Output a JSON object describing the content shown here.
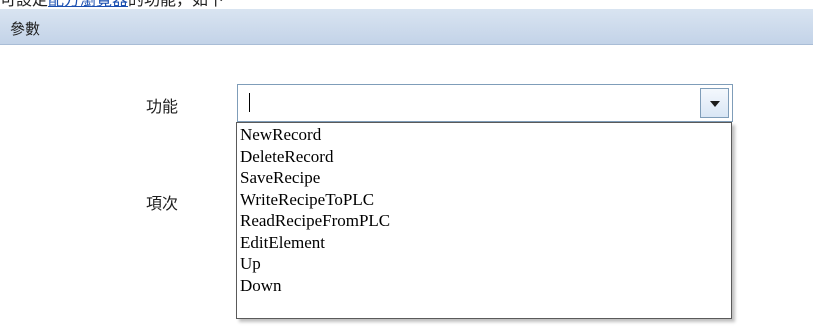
{
  "caption": {
    "prefix": "可設定",
    "link": "配方瀏覽器",
    "suffix": "的功能，如下"
  },
  "group": {
    "title": "參數"
  },
  "form": {
    "function_label": "功能",
    "item_label": "項次",
    "function_value": ""
  },
  "dropdown": {
    "options": [
      "NewRecord",
      "DeleteRecord",
      "SaveRecipe",
      "WriteRecipeToPLC",
      "ReadRecipeFromPLC",
      "EditElement",
      "Up",
      "Down"
    ]
  },
  "icons": {
    "dropdown_toggle": "chevron-down-icon"
  },
  "colors": {
    "header_bar": "#c8d7ea",
    "combo_border": "#7f9db9",
    "link": "#1a4fb0"
  }
}
